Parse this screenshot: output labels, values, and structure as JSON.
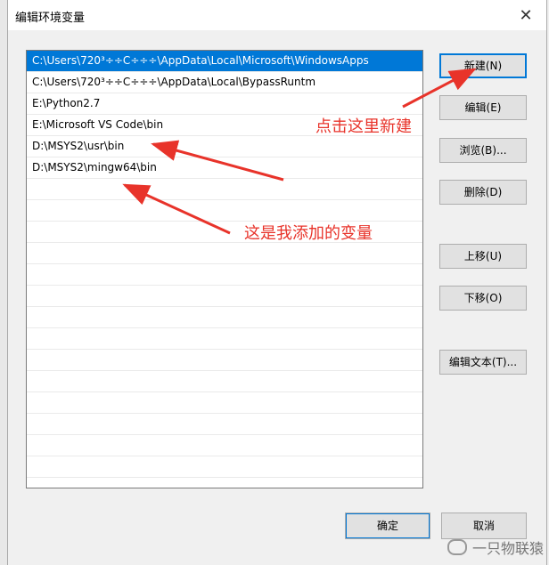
{
  "window": {
    "title": "编辑环境变量",
    "close_glyph": "✕"
  },
  "paths": [
    "C:\\Users\\720³÷÷C÷÷÷\\AppData\\Local\\Microsoft\\WindowsApps",
    "C:\\Users\\720³÷÷C÷÷÷\\AppData\\Local\\BypassRuntm",
    "E:\\Python2.7",
    "E:\\Microsoft VS Code\\bin",
    "D:\\MSYS2\\usr\\bin",
    "D:\\MSYS2\\mingw64\\bin"
  ],
  "buttons": {
    "new": "新建(N)",
    "edit": "编辑(E)",
    "browse": "浏览(B)...",
    "delete": "删除(D)",
    "move_up": "上移(U)",
    "move_down": "下移(O)",
    "edit_text": "编辑文本(T)...",
    "ok": "确定",
    "cancel": "取消"
  },
  "annotations": {
    "click_new": "点击这里新建",
    "added_vars": "这是我添加的变量"
  },
  "watermark": "一只物联猿",
  "colors": {
    "selection": "#0078d7",
    "annotation": "#e8332a"
  }
}
